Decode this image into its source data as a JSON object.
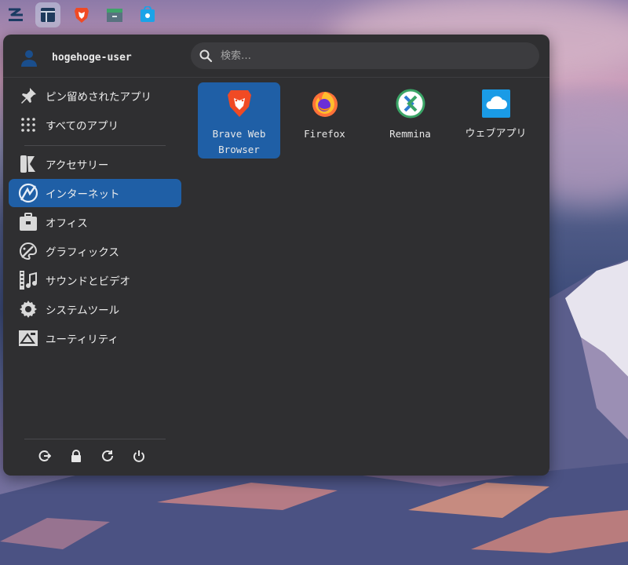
{
  "taskbar": {
    "icons": [
      "zorin-logo-icon",
      "window-menu-icon",
      "brave-icon",
      "file-manager-icon",
      "software-store-icon"
    ]
  },
  "menu": {
    "user": {
      "name": "hogehoge-user",
      "icon": "user-avatar-icon"
    },
    "search": {
      "placeholder": "検索…"
    },
    "top_items": [
      {
        "label": "ピン留めされたアプリ",
        "icon": "pin-icon"
      },
      {
        "label": "すべてのアプリ",
        "icon": "grid-icon"
      }
    ],
    "categories": [
      {
        "label": "アクセサリー",
        "icon": "accessories-icon"
      },
      {
        "label": "インターネット",
        "icon": "internet-icon",
        "selected": true
      },
      {
        "label": "オフィス",
        "icon": "office-icon"
      },
      {
        "label": "グラフィックス",
        "icon": "graphics-icon"
      },
      {
        "label": "サウンドとビデオ",
        "icon": "multimedia-icon"
      },
      {
        "label": "システムツール",
        "icon": "system-tools-icon"
      },
      {
        "label": "ユーティリティ",
        "icon": "utilities-icon"
      }
    ],
    "apps": [
      {
        "line1": "Brave Web",
        "line2": "Browser",
        "icon": "brave-icon",
        "selected": true
      },
      {
        "line1": "Firefox",
        "line2": "",
        "icon": "firefox-icon"
      },
      {
        "line1": "Remmina",
        "line2": "",
        "icon": "remmina-icon"
      },
      {
        "line1": "ウェブアプリ",
        "line2": "",
        "icon": "webapps-icon"
      }
    ],
    "actions": [
      "logout-icon",
      "lock-icon",
      "restart-icon",
      "power-icon"
    ]
  },
  "colors": {
    "menu_bg": "#2f2f31",
    "selection": "#1f5fa6",
    "search_bg": "#3c3c3f"
  }
}
